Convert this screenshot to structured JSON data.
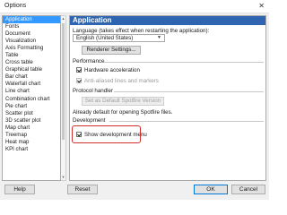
{
  "window": {
    "title": "Options",
    "close_glyph": "✕"
  },
  "sidebar": {
    "items": [
      {
        "label": "Application",
        "selected": true
      },
      {
        "label": "Fonts"
      },
      {
        "label": "Document"
      },
      {
        "label": "Visualization"
      },
      {
        "label": "Axis Formatting"
      },
      {
        "label": "Table"
      },
      {
        "label": "Cross table"
      },
      {
        "label": "Graphical table"
      },
      {
        "label": "Bar chart"
      },
      {
        "label": "Waterfall chart"
      },
      {
        "label": "Line chart"
      },
      {
        "label": "Combination chart"
      },
      {
        "label": "Pie chart"
      },
      {
        "label": "Scatter plot"
      },
      {
        "label": "3D scatter plot"
      },
      {
        "label": "Map chart"
      },
      {
        "label": "Treemap"
      },
      {
        "label": "Heat map"
      },
      {
        "label": "KPI chart"
      }
    ]
  },
  "content": {
    "header": "Application",
    "language_label": "Language (takes effect when restarting the application):",
    "language_value": "English (United States)",
    "renderer_button": "Renderer Settings...",
    "performance": {
      "heading": "Performance",
      "hardware_accel": {
        "label": "Hardware acceleration",
        "checked": true
      },
      "antialias": {
        "label": "Anti-aliased lines and markers",
        "checked": true,
        "disabled": true
      }
    },
    "protocol": {
      "heading": "Protocol handler",
      "set_default_button": "Set as Default Spotfire Version",
      "status_text": "Already default for opening Spotfire files."
    },
    "development": {
      "heading": "Development",
      "show_menu": {
        "label": "Show development menu",
        "checked": true
      }
    }
  },
  "footer": {
    "help": "Help",
    "reset": "Reset",
    "ok": "OK",
    "cancel": "Cancel"
  },
  "colors": {
    "selection": "#3399ff",
    "header": "#2f65b0",
    "annotation": "#d0312d"
  }
}
